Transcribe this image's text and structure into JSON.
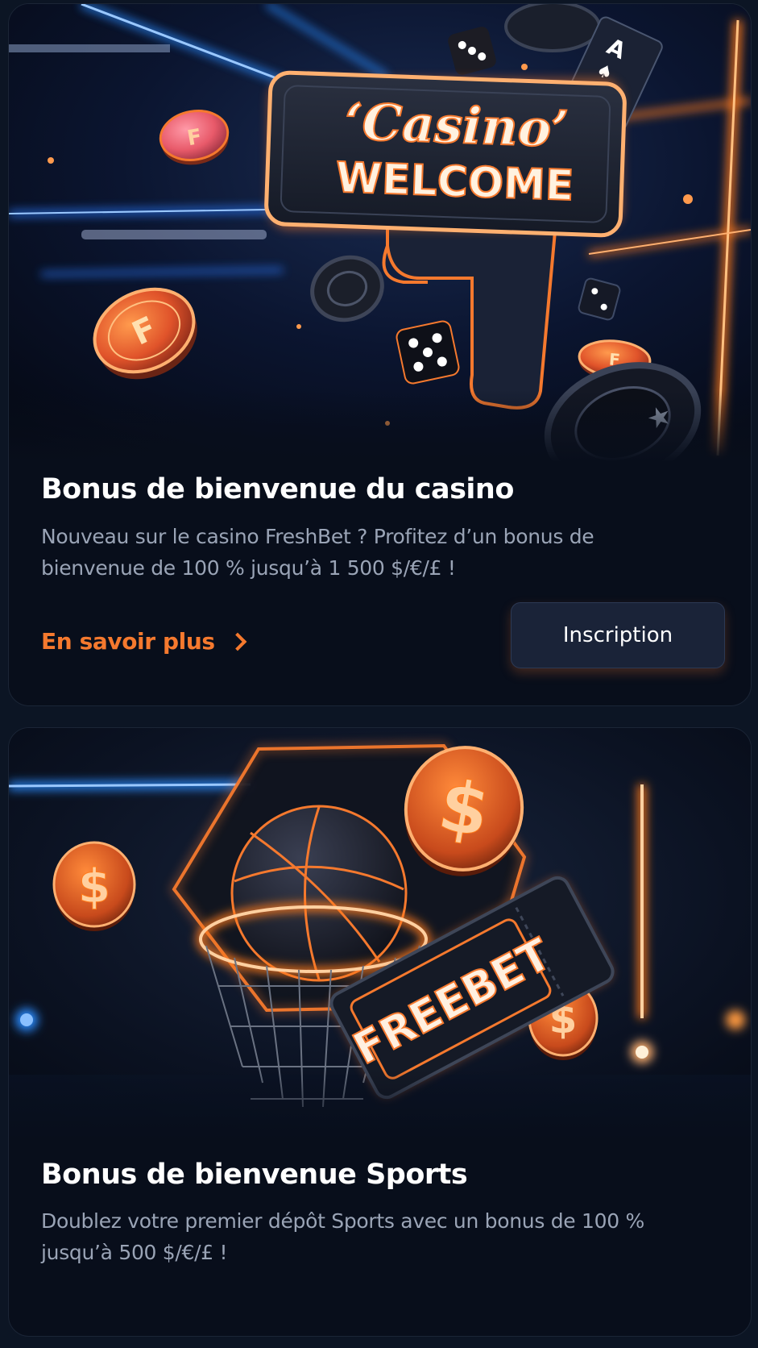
{
  "colors": {
    "page_background": "#0c1524",
    "card_background": "#080e1b",
    "accent_orange": "#f5792e",
    "text_primary": "#ffffff",
    "text_secondary": "#9aa4b6",
    "button_background": "#1a2338"
  },
  "promos": [
    {
      "banner": {
        "sign_line_1": "‘Casino’",
        "sign_line_2": "WELCOME",
        "chip_letter": "F",
        "card_letter": "A"
      },
      "title": "Bonus de bienvenue du casino",
      "description": "Nouveau sur le casino FreshBet ? Profitez d’un bonus de bienvenue de 100 % jusqu’à 1 500 $/€/£ !",
      "more_link": "En savoir plus",
      "signup_button": "Inscription"
    },
    {
      "banner": {
        "ticket_text": "FREEBET",
        "coin_symbol": "$"
      },
      "title": "Bonus de bienvenue Sports",
      "description": "Doublez votre premier dépôt Sports avec un bonus de 100 % jusqu’à 500 $/€/£ !"
    }
  ]
}
